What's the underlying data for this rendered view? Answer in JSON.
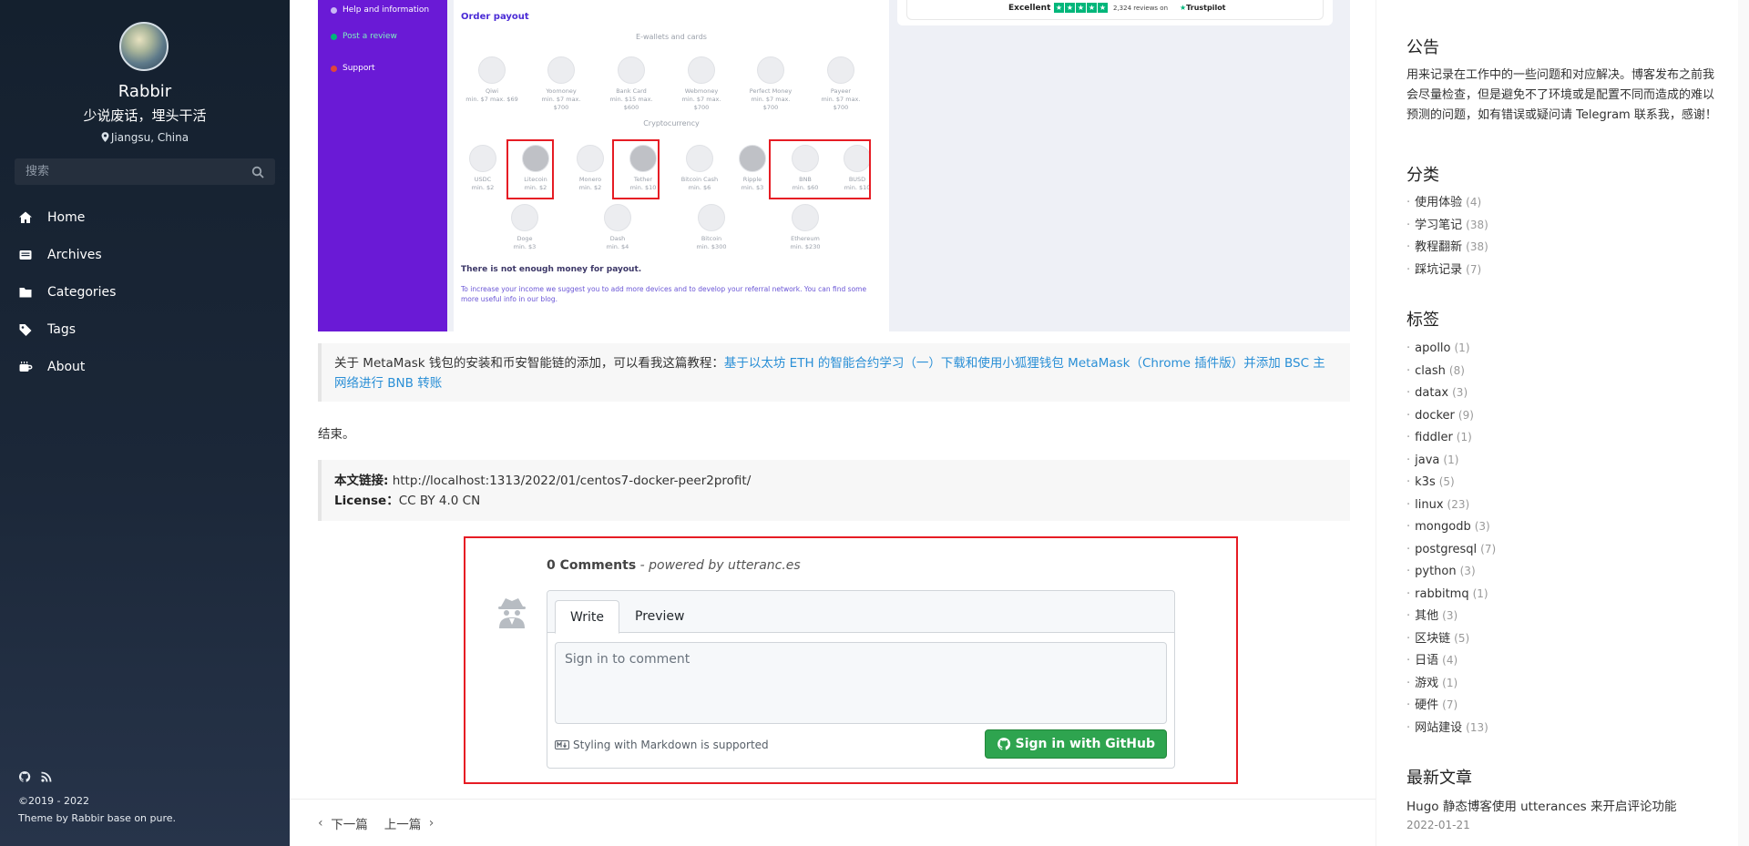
{
  "sidebar": {
    "author": "Rabbir",
    "motto": "少说废话，埋头干活",
    "location": "Jiangsu, China",
    "search_placeholder": "搜索",
    "nav": [
      {
        "label": "Home",
        "icon": "home-icon"
      },
      {
        "label": "Archives",
        "icon": "archive-icon"
      },
      {
        "label": "Categories",
        "icon": "folder-icon"
      },
      {
        "label": "Tags",
        "icon": "tag-icon"
      },
      {
        "label": "About",
        "icon": "coffee-icon"
      }
    ],
    "footer_icons": [
      "github-icon",
      "rss-icon"
    ],
    "copyright": "©2019 - 2022",
    "theme": "Theme by Rabbir base on pure."
  },
  "screenshot": {
    "side_items": [
      {
        "label": "Help and information",
        "icon": "help-icon",
        "color": "#c9b7f5"
      },
      {
        "label": "Post a review",
        "icon": "star-icon",
        "color": "#00b67a"
      },
      {
        "label": "Support",
        "icon": "support-icon",
        "color": "#e0453a"
      }
    ],
    "order_payout": "Order payout",
    "ewallets_heading": "E-wallets and cards",
    "ewallets": [
      {
        "name": "Qiwi",
        "min": "min. $7 max. $69"
      },
      {
        "name": "Yoomoney",
        "min": "min. $7 max. $700"
      },
      {
        "name": "Bank Card",
        "min": "min. $15 max. $600"
      },
      {
        "name": "Webmoney",
        "min": "min. $7 max. $700"
      },
      {
        "name": "Perfect Money",
        "min": "min. $7 max. $700"
      },
      {
        "name": "Payeer",
        "min": "min. $7 max. $700"
      }
    ],
    "crypto_heading": "Cryptocurrency",
    "crypto_row1": [
      {
        "name": "USDC",
        "min": "min. $2"
      },
      {
        "name": "Litecoin",
        "min": "min. $2"
      },
      {
        "name": "Monero",
        "min": "min. $2"
      },
      {
        "name": "Tether",
        "min": "min. $10"
      },
      {
        "name": "Bitcoin Cash",
        "min": "min. $6"
      },
      {
        "name": "Ripple",
        "min": "min. $3"
      },
      {
        "name": "BNB",
        "min": "min. $60"
      },
      {
        "name": "BUSD",
        "min": "min. $10"
      }
    ],
    "crypto_row2": [
      {
        "name": "Doge",
        "min": "min. $3"
      },
      {
        "name": "Dash",
        "min": "min. $4"
      },
      {
        "name": "Bitcoin",
        "min": "min. $300"
      },
      {
        "name": "Ethereum",
        "min": "min. $230"
      }
    ],
    "not_enough": "There is not enough money for payout.",
    "increase": "To increase your income we suggest you to add more devices and to develop your referral network. You can find some more useful info in our blog.",
    "trustpilot": {
      "excellent": "Excellent",
      "reviews": "2,324 reviews on",
      "brand": "Trustpilot"
    }
  },
  "article": {
    "quote_prefix": "关于 MetaMask 钱包的安装和币安智能链的添加，可以看我这篇教程：",
    "quote_link": "基于以太坊 ETH 的智能合约学习（一）下载和使用小狐狸钱包 MetaMask（Chrome 插件版）并添加 BSC 主网络进行 BNB 转账",
    "end": "结束。",
    "link_label": "本文链接:",
    "link_url": "http://localhost:1313/2022/01/centos7-docker-peer2profit/",
    "license_label": "License：",
    "license_value": "CC BY 4.0 CN"
  },
  "comments": {
    "count": "0 Comments",
    "powered": "- powered by utteranc.es",
    "tab_write": "Write",
    "tab_preview": "Preview",
    "placeholder": "Sign in to comment",
    "markdown_note": "Styling with Markdown is supported",
    "signin": "Sign in with GitHub"
  },
  "pager": {
    "next": "下一篇",
    "prev": "上一篇"
  },
  "right": {
    "notice_title": "公告",
    "notice_text": "用来记录在工作中的一些问题和对应解决。博客发布之前我会尽量检查，但是避免不了环境或是配置不同而造成的难以预测的问题，如有错误或疑问请 Telegram 联系我，感谢！",
    "categories_title": "分类",
    "categories": [
      {
        "name": "使用体验",
        "count": "(4)"
      },
      {
        "name": "学习笔记",
        "count": "(38)"
      },
      {
        "name": "教程翻新",
        "count": "(38)"
      },
      {
        "name": "踩坑记录",
        "count": "(7)"
      }
    ],
    "tags_title": "标签",
    "tags": [
      {
        "name": "apollo",
        "count": "(1)"
      },
      {
        "name": "clash",
        "count": "(8)"
      },
      {
        "name": "datax",
        "count": "(3)"
      },
      {
        "name": "docker",
        "count": "(9)"
      },
      {
        "name": "fiddler",
        "count": "(1)"
      },
      {
        "name": "java",
        "count": "(1)"
      },
      {
        "name": "k3s",
        "count": "(5)"
      },
      {
        "name": "linux",
        "count": "(23)"
      },
      {
        "name": "mongodb",
        "count": "(3)"
      },
      {
        "name": "postgresql",
        "count": "(7)"
      },
      {
        "name": "python",
        "count": "(3)"
      },
      {
        "name": "rabbitmq",
        "count": "(1)"
      },
      {
        "name": "其他",
        "count": "(3)"
      },
      {
        "name": "区块链",
        "count": "(5)"
      },
      {
        "name": "日语",
        "count": "(4)"
      },
      {
        "name": "游戏",
        "count": "(1)"
      },
      {
        "name": "硬件",
        "count": "(7)"
      },
      {
        "name": "网站建设",
        "count": "(13)"
      }
    ],
    "latest_title": "最新文章",
    "latest_post": "Hugo 静态博客使用 utterances 来开启评论功能",
    "latest_date": "2022-01-21"
  }
}
